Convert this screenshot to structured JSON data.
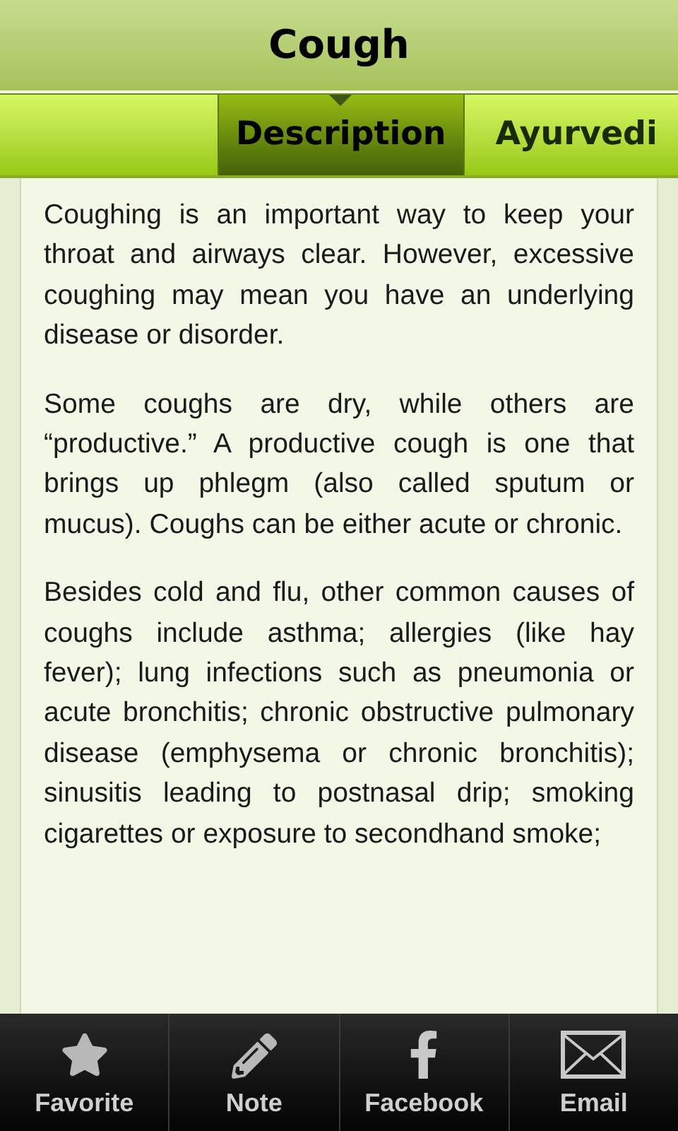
{
  "header": {
    "title": "Cough"
  },
  "tabs": [
    {
      "label": "Description",
      "selected": true
    },
    {
      "label": "Ayurvedi",
      "selected": false
    }
  ],
  "paragraphs": [
    "Coughing is an important way to keep your throat and airways clear. However, excessive coughing may mean you have an underlying disease or disorder.",
    "Some coughs are dry, while others are “productive.” A productive cough is one that brings up phlegm (also called sputum or mucus). Coughs can be either acute or chronic.",
    "Besides cold and flu, other common causes of coughs include asthma; allergies (like hay fever); lung infections such as pneumonia or acute bronchitis; chronic obstructive pulmonary disease (emphysema or chronic bronchitis); sinusitis leading to postnasal drip; smoking cigarettes or exposure to secondhand smoke;"
  ],
  "bottom_bar": [
    {
      "kind": "star",
      "label": "Favorite"
    },
    {
      "kind": "pencil",
      "label": "Note"
    },
    {
      "kind": "facebook",
      "label": "Facebook"
    },
    {
      "kind": "mail",
      "label": "Email"
    }
  ]
}
